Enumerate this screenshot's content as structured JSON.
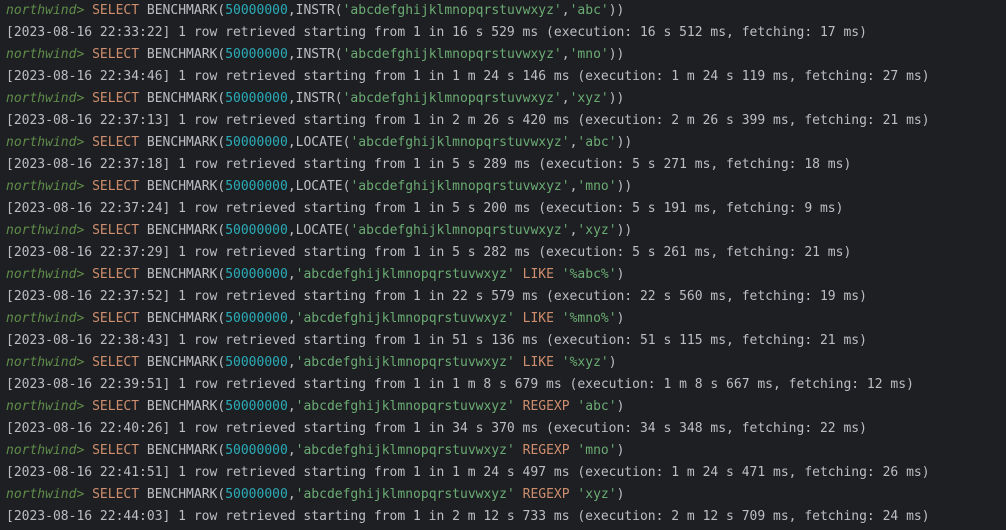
{
  "colors": {
    "background": "#1e1f22",
    "text": "#bcbec4",
    "prompt": "#5f8d4a",
    "keyword": "#cf8e6d",
    "number": "#2aacb8",
    "string": "#6aab73"
  },
  "console": {
    "lines": [
      {
        "type": "query",
        "prompt": "northwind>",
        "keyword": "SELECT",
        "fn": "BENCHMARK(",
        "num": "50000000",
        "mid": ",INSTR(",
        "str1": "'abcdefghijklmnopqrstuvwxyz'",
        "sep": ",",
        "op": "",
        "str2": "'abc'",
        "end": "))"
      },
      {
        "type": "result",
        "text": "[2023-08-16 22:33:22] 1 row retrieved starting from 1 in 16 s 529 ms (execution: 16 s 512 ms, fetching: 17 ms)"
      },
      {
        "type": "query",
        "prompt": "northwind>",
        "keyword": "SELECT",
        "fn": "BENCHMARK(",
        "num": "50000000",
        "mid": ",INSTR(",
        "str1": "'abcdefghijklmnopqrstuvwxyz'",
        "sep": ",",
        "op": "",
        "str2": "'mno'",
        "end": "))"
      },
      {
        "type": "result",
        "text": "[2023-08-16 22:34:46] 1 row retrieved starting from 1 in 1 m 24 s 146 ms (execution: 1 m 24 s 119 ms, fetching: 27 ms)"
      },
      {
        "type": "query",
        "prompt": "northwind>",
        "keyword": "SELECT",
        "fn": "BENCHMARK(",
        "num": "50000000",
        "mid": ",INSTR(",
        "str1": "'abcdefghijklmnopqrstuvwxyz'",
        "sep": ",",
        "op": "",
        "str2": "'xyz'",
        "end": "))"
      },
      {
        "type": "result",
        "text": "[2023-08-16 22:37:13] 1 row retrieved starting from 1 in 2 m 26 s 420 ms (execution: 2 m 26 s 399 ms, fetching: 21 ms)"
      },
      {
        "type": "query",
        "prompt": "northwind>",
        "keyword": "SELECT",
        "fn": "BENCHMARK(",
        "num": "50000000",
        "mid": ",LOCATE(",
        "str1": "'abcdefghijklmnopqrstuvwxyz'",
        "sep": ",",
        "op": "",
        "str2": "'abc'",
        "end": "))"
      },
      {
        "type": "result",
        "text": "[2023-08-16 22:37:18] 1 row retrieved starting from 1 in 5 s 289 ms (execution: 5 s 271 ms, fetching: 18 ms)"
      },
      {
        "type": "query",
        "prompt": "northwind>",
        "keyword": "SELECT",
        "fn": "BENCHMARK(",
        "num": "50000000",
        "mid": ",LOCATE(",
        "str1": "'abcdefghijklmnopqrstuvwxyz'",
        "sep": ",",
        "op": "",
        "str2": "'mno'",
        "end": "))"
      },
      {
        "type": "result",
        "text": "[2023-08-16 22:37:24] 1 row retrieved starting from 1 in 5 s 200 ms (execution: 5 s 191 ms, fetching: 9 ms)"
      },
      {
        "type": "query",
        "prompt": "northwind>",
        "keyword": "SELECT",
        "fn": "BENCHMARK(",
        "num": "50000000",
        "mid": ",LOCATE(",
        "str1": "'abcdefghijklmnopqrstuvwxyz'",
        "sep": ",",
        "op": "",
        "str2": "'xyz'",
        "end": "))"
      },
      {
        "type": "result",
        "text": "[2023-08-16 22:37:29] 1 row retrieved starting from 1 in 5 s 282 ms (execution: 5 s 261 ms, fetching: 21 ms)"
      },
      {
        "type": "query",
        "prompt": "northwind>",
        "keyword": "SELECT",
        "fn": "BENCHMARK(",
        "num": "50000000",
        "mid": ",",
        "str1": "'abcdefghijklmnopqrstuvwxyz'",
        "sep": " ",
        "op": "LIKE",
        "str2": " '%abc%'",
        "end": ")"
      },
      {
        "type": "result",
        "text": "[2023-08-16 22:37:52] 1 row retrieved starting from 1 in 22 s 579 ms (execution: 22 s 560 ms, fetching: 19 ms)"
      },
      {
        "type": "query",
        "prompt": "northwind>",
        "keyword": "SELECT",
        "fn": "BENCHMARK(",
        "num": "50000000",
        "mid": ",",
        "str1": "'abcdefghijklmnopqrstuvwxyz'",
        "sep": " ",
        "op": "LIKE",
        "str2": " '%mno%'",
        "end": ")"
      },
      {
        "type": "result",
        "text": "[2023-08-16 22:38:43] 1 row retrieved starting from 1 in 51 s 136 ms (execution: 51 s 115 ms, fetching: 21 ms)"
      },
      {
        "type": "query",
        "prompt": "northwind>",
        "keyword": "SELECT",
        "fn": "BENCHMARK(",
        "num": "50000000",
        "mid": ",",
        "str1": "'abcdefghijklmnopqrstuvwxyz'",
        "sep": " ",
        "op": "LIKE",
        "str2": " '%xyz'",
        "end": ")"
      },
      {
        "type": "result",
        "text": "[2023-08-16 22:39:51] 1 row retrieved starting from 1 in 1 m 8 s 679 ms (execution: 1 m 8 s 667 ms, fetching: 12 ms)"
      },
      {
        "type": "query",
        "prompt": "northwind>",
        "keyword": "SELECT",
        "fn": "BENCHMARK(",
        "num": "50000000",
        "mid": ",",
        "str1": "'abcdefghijklmnopqrstuvwxyz'",
        "sep": " ",
        "op": "REGEXP",
        "str2": " 'abc'",
        "end": ")"
      },
      {
        "type": "result",
        "text": "[2023-08-16 22:40:26] 1 row retrieved starting from 1 in 34 s 370 ms (execution: 34 s 348 ms, fetching: 22 ms)"
      },
      {
        "type": "query",
        "prompt": "northwind>",
        "keyword": "SELECT",
        "fn": "BENCHMARK(",
        "num": "50000000",
        "mid": ",",
        "str1": "'abcdefghijklmnopqrstuvwxyz'",
        "sep": " ",
        "op": "REGEXP",
        "str2": " 'mno'",
        "end": ")"
      },
      {
        "type": "result",
        "text": "[2023-08-16 22:41:51] 1 row retrieved starting from 1 in 1 m 24 s 497 ms (execution: 1 m 24 s 471 ms, fetching: 26 ms)"
      },
      {
        "type": "query",
        "prompt": "northwind>",
        "keyword": "SELECT",
        "fn": "BENCHMARK(",
        "num": "50000000",
        "mid": ",",
        "str1": "'abcdefghijklmnopqrstuvwxyz'",
        "sep": " ",
        "op": "REGEXP",
        "str2": " 'xyz'",
        "end": ")"
      },
      {
        "type": "result",
        "text": "[2023-08-16 22:44:03] 1 row retrieved starting from 1 in 2 m 12 s 733 ms (execution: 2 m 12 s 709 ms, fetching: 24 ms)"
      }
    ]
  }
}
